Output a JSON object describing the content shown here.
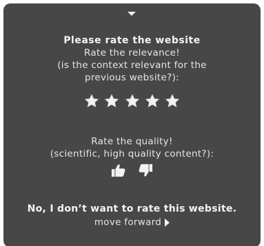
{
  "rating_panel": {
    "heading": "Please rate the website",
    "relevance": {
      "prompt": "Rate the relevance!",
      "subprompt_line1": "(is the context relevant for the",
      "subprompt_line2": "previous website?):",
      "stars_max": 5,
      "icon": "star-icon"
    },
    "quality": {
      "prompt": "Rate the quality!",
      "subprompt": "(scientific, high quality content?):",
      "thumbs_up_icon": "thumbs-up-icon",
      "thumbs_down_icon": "thumbs-down-icon"
    },
    "decline_label": "No, I don’t want to rate this website.",
    "move_forward_label": "move forward",
    "colors": {
      "panel_background": "#474747",
      "text": "#e6e6e6",
      "icon": "#f2f2f2"
    }
  }
}
